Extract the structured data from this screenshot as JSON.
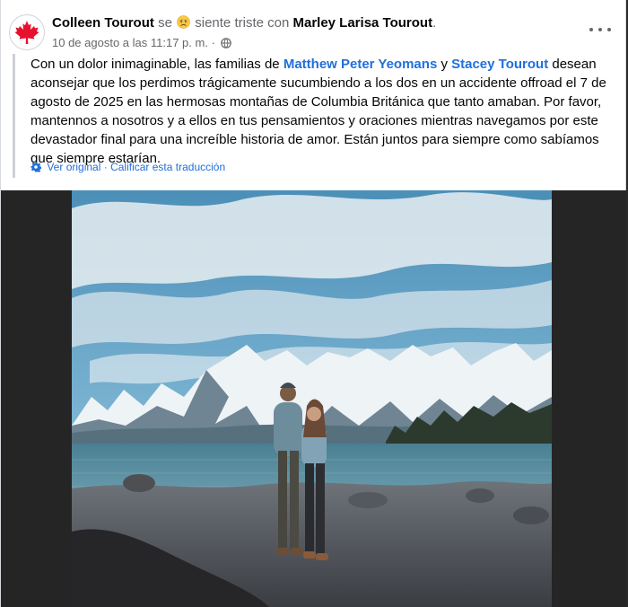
{
  "post": {
    "author": "Colleen Tourout",
    "feeling_prefix": "se",
    "feeling_text": "siente triste con",
    "tagged": "Marley Larisa Tourout",
    "tagged_suffix": ".",
    "timestamp": "10 de agosto a las 11:17 p. m.",
    "separator": "·",
    "body": {
      "part1": "Con un dolor inimaginable, las familias de ",
      "mention1": "Matthew Peter Yeomans",
      "part2": " y ",
      "mention2": "Stacey Tourout",
      "part3": " desean aconsejar que los perdimos trágicamente sucumbiendo a los dos en un accidente offroad el 7 de agosto de 2025 en las hermosas montañas de Columbia Británica que tanto amaban. Por favor, mantennos a nosotros y a ellos en tus pensamientos y oraciones mientras navegamos por este devastador final para una increíble historia de amor. Están juntos para siempre como sabíamos que siempre estarían."
    },
    "translation": {
      "view_original": "Ver original",
      "separator": "·",
      "rate": "Calificar esta traducción"
    }
  },
  "icons": {
    "avatar": "canada-flag-maple-leaf",
    "feeling": "sad-face-emoji",
    "audience": "globe-icon",
    "more": "more-options-icon",
    "translate": "gear-icon"
  },
  "colors": {
    "link": "#216fdb",
    "secondary_text": "#65676b",
    "maple_leaf": "#e8112d"
  }
}
